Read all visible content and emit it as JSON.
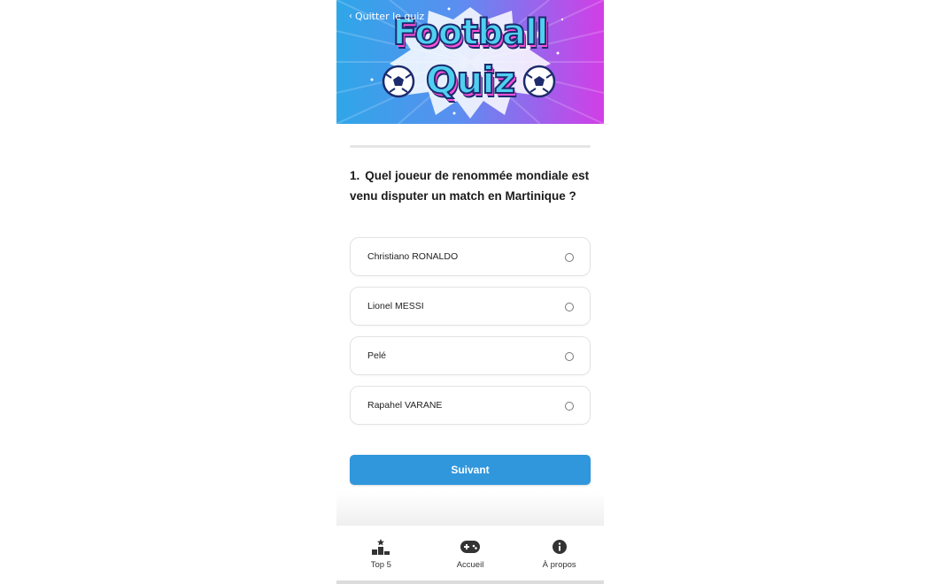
{
  "banner": {
    "back_label": "Quitter le quiz",
    "back_icon": "chevron-left-icon",
    "title_line1": "Football",
    "title_line2": "Quiz",
    "colors": {
      "gradient_start": "#2fa6e8",
      "gradient_end": "#d23ee6",
      "title_fill": "#4fd0f0",
      "title_outline": "#1d2b6e",
      "title_shadow": "#ff4fd8"
    }
  },
  "question": {
    "number": "1.",
    "text": "Quel joueur de renommée mondiale est venu disputer un match en Martinique ?"
  },
  "options": [
    {
      "label": "Christiano RONALDO"
    },
    {
      "label": "Lionel MESSI"
    },
    {
      "label": "Pelé"
    },
    {
      "label": "Rapahel VARANE"
    }
  ],
  "next_button": {
    "label": "Suivant",
    "color": "#3197dc"
  },
  "bottom_nav": {
    "items": [
      {
        "label": "Top 5",
        "icon": "podium-icon"
      },
      {
        "label": "Accueil",
        "icon": "gamepad-icon"
      },
      {
        "label": "À propos",
        "icon": "info-icon"
      }
    ]
  }
}
